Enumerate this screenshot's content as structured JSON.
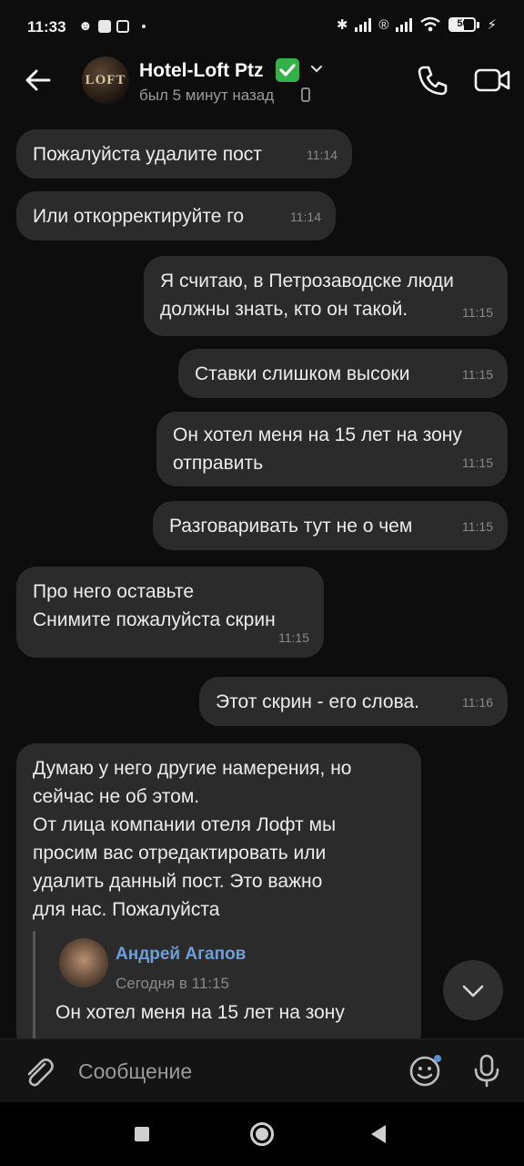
{
  "status_bar": {
    "time": "11:33",
    "battery": "56",
    "battery_level": 0.56
  },
  "header": {
    "chat_name": "Hotel-Loft Ptz",
    "last_seen": "был 5 минут назад",
    "avatar_text": "LOFT"
  },
  "messages": [
    {
      "direction": "in",
      "text": "Пожалуйста удалите пост",
      "time": "11:14"
    },
    {
      "direction": "in",
      "text": "Или откорректируйте го",
      "time": "11:14"
    },
    {
      "direction": "out",
      "text": "Я считаю, в Петрозаводске люди\nдолжны знать, кто он такой.",
      "time": "11:15"
    },
    {
      "direction": "out",
      "text": "Ставки слишком высоки",
      "time": "11:15"
    },
    {
      "direction": "out",
      "text": "Он хотел меня на 15 лет на зону\nотправить",
      "time": "11:15"
    },
    {
      "direction": "out",
      "text": "Разговаривать тут не о чем",
      "time": "11:15"
    },
    {
      "direction": "in",
      "text": "Про него оставьте\nСнимите пожалуйста скрин",
      "time": "11:15"
    },
    {
      "direction": "out",
      "text": "Этот скрин - его слова.",
      "time": "11:16"
    },
    {
      "direction": "in",
      "text": "Думаю у него другие намерения, но\nсейчас не об этом.\nОт лица компании отеля Лофт мы\nпросим вас отредактировать или\nудалить данный пост. Это важно\nдля нас. Пожалуйста",
      "quote": {
        "author": "Андрей Агапов",
        "date": "Сегодня в 11:15",
        "text": "Он хотел меня на 15 лет на зону"
      }
    }
  ],
  "input": {
    "placeholder": "Сообщение"
  },
  "colors": {
    "background": "#0d0d0d",
    "bubble": "#2b2b2b",
    "accent_link": "#6e9fd8",
    "verified": "#32b34a"
  }
}
